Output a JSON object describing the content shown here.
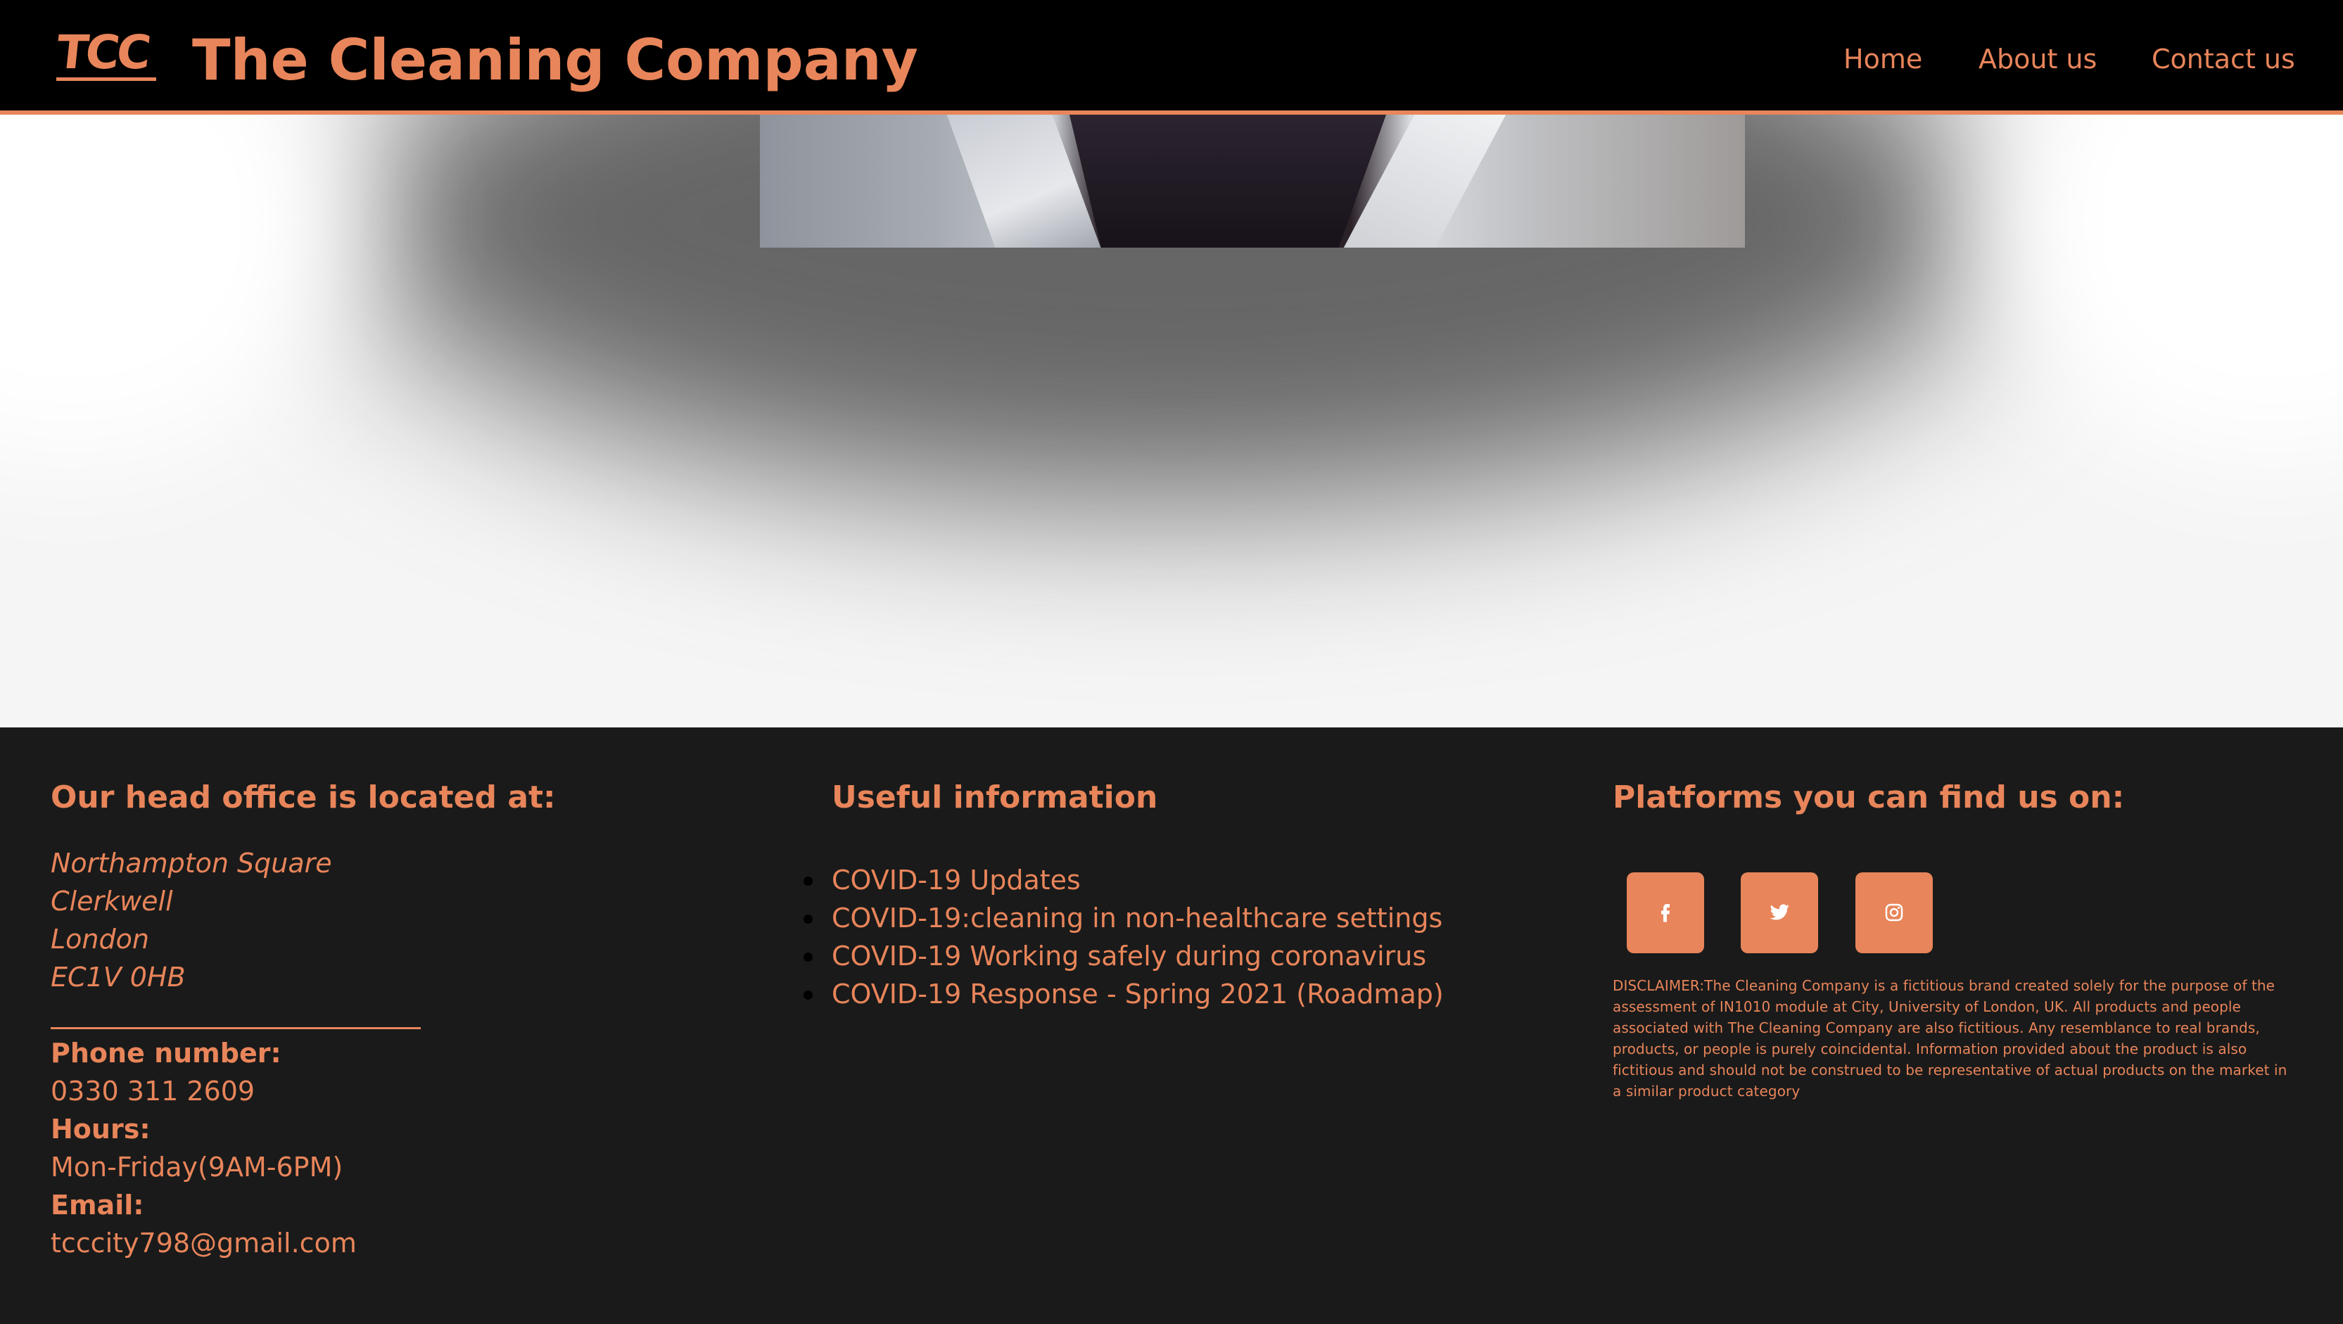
{
  "header": {
    "logo_text": "TCC",
    "brand": "The Cleaning Company",
    "nav": [
      {
        "label": "Home"
      },
      {
        "label": "About us"
      },
      {
        "label": "Contact us"
      }
    ]
  },
  "footer": {
    "office": {
      "heading": "Our head office is located at:",
      "address": [
        "Northampton Square",
        "Clerkwell",
        "London",
        "EC1V 0HB"
      ],
      "phone_label": "Phone number:",
      "phone": "0330 311 2609",
      "hours_label": "Hours:",
      "hours": "Mon-Friday(9AM-6PM)",
      "email_label": "Email:",
      "email": "tcccity798@gmail.com"
    },
    "info": {
      "heading": "Useful information",
      "links": [
        "COVID-19 Updates",
        "COVID-19:cleaning in non-healthcare settings",
        "COVID-19 Working safely during coronavirus",
        "COVID-19 Response - Spring 2021 (Roadmap)"
      ]
    },
    "platforms": {
      "heading": "Platforms you can find us on:",
      "icons": [
        "facebook-icon",
        "twitter-icon",
        "instagram-icon"
      ],
      "disclaimer": "DISCLAIMER:The Cleaning Company is a fictitious brand created solely for the purpose of the assessment of IN1010 module at City, University of London, UK. All products and people associated with The Cleaning Company are also fictitious. Any resemblance to real brands, products, or people is purely coincidental. Information provided about the product is also fictitious and should not be construed to be representative of actual products on the market in a similar product category"
    }
  },
  "colors": {
    "accent": "#e8855a",
    "header_bg": "#000000",
    "footer_bg": "#1a1a1a"
  }
}
